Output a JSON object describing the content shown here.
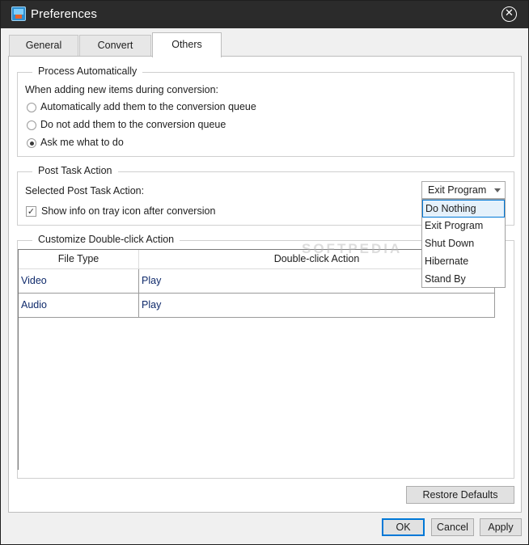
{
  "window": {
    "title": "Preferences"
  },
  "tabs": [
    {
      "label": "General"
    },
    {
      "label": "Convert"
    },
    {
      "label": "Others"
    }
  ],
  "process_automatically": {
    "legend": "Process Automatically",
    "description": "When adding new items during conversion:",
    "options": [
      {
        "label": "Automatically add them to the conversion queue",
        "selected": false
      },
      {
        "label": "Do not add them to the conversion queue",
        "selected": false
      },
      {
        "label": "Ask me what to do",
        "selected": true
      }
    ]
  },
  "post_task": {
    "legend": "Post Task Action",
    "selected_label": "Selected Post Task Action:",
    "combo_value": "Exit Program",
    "dropdown_options": [
      "Do Nothing",
      "Exit Program",
      "Shut Down",
      "Hibernate",
      "Stand By"
    ],
    "highlighted_option": "Do Nothing",
    "tray_checkbox_label": "Show info on tray icon after conversion",
    "tray_checkbox_checked": true
  },
  "double_click": {
    "legend": "Customize Double-click Action",
    "columns": [
      "File Type",
      "Double-click Action"
    ],
    "rows": [
      {
        "type": "Video",
        "action": "Play"
      },
      {
        "type": "Audio",
        "action": "Play"
      }
    ]
  },
  "watermark": "SOFTPEDIA",
  "buttons": {
    "restore_defaults": "Restore Defaults",
    "ok": "OK",
    "cancel": "Cancel",
    "apply": "Apply"
  },
  "icons": {
    "app": "app-icon",
    "close": "close-icon",
    "dropdown": "chevron-down-icon",
    "check": "checkmark-icon"
  }
}
